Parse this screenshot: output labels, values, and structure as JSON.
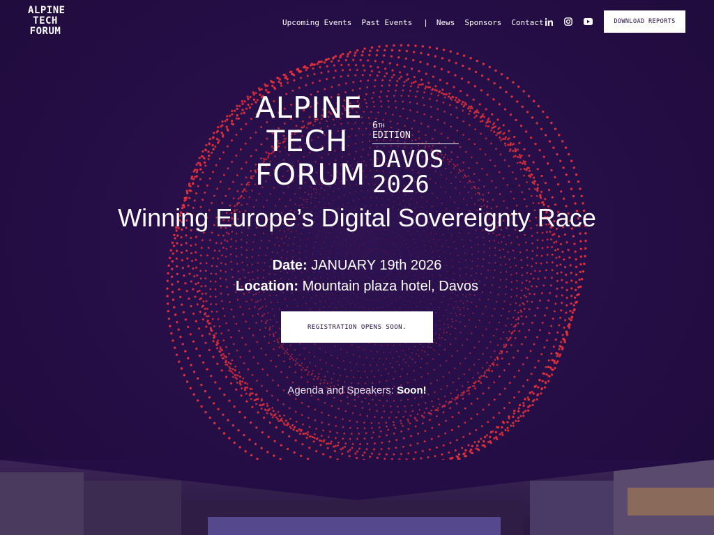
{
  "brand": {
    "logo_lines": [
      "ALPINE",
      "TECH",
      "FORUM"
    ]
  },
  "nav": {
    "items": [
      "Upcoming Events",
      "Past Events",
      "|",
      "News",
      "Sponsors",
      "Contact"
    ]
  },
  "social": {
    "icons": [
      "linkedin-icon",
      "instagram-icon",
      "youtube-icon"
    ]
  },
  "header": {
    "download_label": "DOWNLOAD REPORTS"
  },
  "event_logo": {
    "lines": [
      "ALPINE",
      "TECH",
      "FORUM"
    ],
    "edition_number": "6",
    "edition_suffix": "TH",
    "edition_word": "EDITION",
    "city": "DAVOS",
    "year": "2026"
  },
  "hero": {
    "headline": "Winning Europe’s Digital Sovereignty Race",
    "date_label": "Date:",
    "date_value": "JANUARY 19th 2026",
    "location_label": "Location:",
    "location_value": "Mountain plaza hotel, Davos",
    "registration_label": "REGISTRATION OPENS SOON.",
    "agenda_text": "Agenda and Speakers:",
    "agenda_status": "Soon!"
  },
  "colors": {
    "background": "#240d44",
    "sphere_dots": "#e8333a",
    "button_bg": "#ffffff",
    "button_text": "#240d44"
  }
}
